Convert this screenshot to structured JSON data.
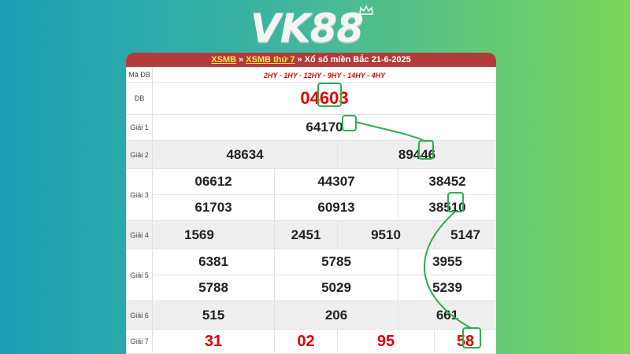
{
  "logo": {
    "text_vk": "VK",
    "text_num": "88"
  },
  "breadcrumb": {
    "link1": "XSMB",
    "link2": "XSMB thứ 7",
    "current": "Xổ số miền Bắc 21-6-2025",
    "separator": "»"
  },
  "table": {
    "code_label": "Mã ĐB",
    "code_value": "2HY - 1HY - 12HY - 9HY - 14HY - 4HY",
    "db_label": "ĐB",
    "db_value": "04603",
    "g1_label": "Giải 1",
    "g1_value": "64170",
    "g2_label": "Giải 2",
    "g2_values": [
      "48634",
      "89446"
    ],
    "g3_label": "Giải 3",
    "g3_values": [
      "06612",
      "44307",
      "38452",
      "61703",
      "60913",
      "38510"
    ],
    "g4_label": "Giải 4",
    "g4_values": [
      "1569",
      "2451",
      "9510",
      "5147"
    ],
    "g5_label": "Giải 5",
    "g5_values": [
      "6381",
      "5785",
      "3955",
      "5788",
      "5029",
      "5239"
    ],
    "g6_label": "Giải 6",
    "g6_values": [
      "515",
      "206",
      "661"
    ],
    "g7_label": "Giải 7",
    "g7_values": [
      "31",
      "02",
      "95",
      "58"
    ]
  },
  "colors": {
    "header_bg": "#b33a3a",
    "link_yellow": "#ffe44d",
    "prize_red": "#e00000",
    "highlight_green": "#2fae4f"
  }
}
